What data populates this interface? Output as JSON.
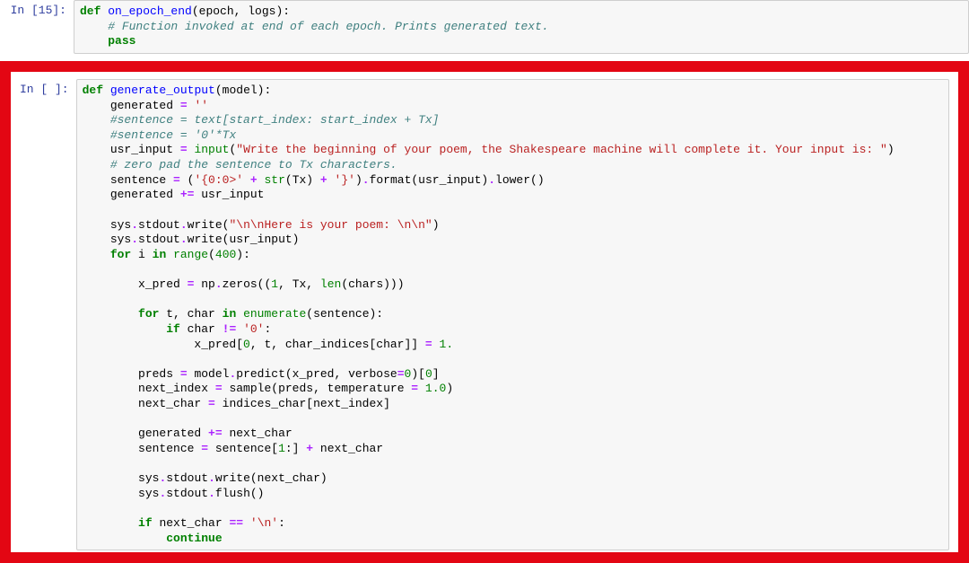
{
  "cell1": {
    "prompt": "In [15]:",
    "lines": [
      [
        [
          "def",
          "kw"
        ],
        [
          " ",
          ""
        ],
        [
          "on_epoch_end",
          "fn"
        ],
        [
          "(epoch, logs):",
          ""
        ]
      ],
      [
        [
          "    ",
          ""
        ],
        [
          "# Function invoked at end of each epoch. Prints generated text.",
          "cm"
        ]
      ],
      [
        [
          "    ",
          ""
        ],
        [
          "pass",
          "kw"
        ]
      ]
    ]
  },
  "cell2": {
    "prompt": "In [ ]:",
    "lines": [
      [
        [
          "def",
          "kw"
        ],
        [
          " ",
          ""
        ],
        [
          "generate_output",
          "fn"
        ],
        [
          "(model):",
          ""
        ]
      ],
      [
        [
          "    generated ",
          ""
        ],
        [
          "=",
          "op"
        ],
        [
          " ",
          ""
        ],
        [
          "''",
          "str"
        ]
      ],
      [
        [
          "    ",
          ""
        ],
        [
          "#sentence = text[start_index: start_index + Tx]",
          "cm"
        ]
      ],
      [
        [
          "    ",
          ""
        ],
        [
          "#sentence = '0'*Tx",
          "cm"
        ]
      ],
      [
        [
          "    usr_input ",
          ""
        ],
        [
          "=",
          "op"
        ],
        [
          " ",
          ""
        ],
        [
          "input",
          "bi"
        ],
        [
          "(",
          ""
        ],
        [
          "\"Write the beginning of your poem, the Shakespeare machine will complete it. Your input is: \"",
          "str"
        ],
        [
          ")",
          ""
        ]
      ],
      [
        [
          "    ",
          ""
        ],
        [
          "# zero pad the sentence to Tx characters.",
          "cm"
        ]
      ],
      [
        [
          "    sentence ",
          ""
        ],
        [
          "=",
          "op"
        ],
        [
          " (",
          ""
        ],
        [
          "'{0:0>'",
          "str"
        ],
        [
          " ",
          ""
        ],
        [
          "+",
          "op"
        ],
        [
          " ",
          ""
        ],
        [
          "str",
          "bi"
        ],
        [
          "(Tx) ",
          ""
        ],
        [
          "+",
          "op"
        ],
        [
          " ",
          ""
        ],
        [
          "'}'",
          "str"
        ],
        [
          ")",
          ""
        ],
        [
          ".",
          "op"
        ],
        [
          "format(usr_input)",
          ""
        ],
        [
          ".",
          "op"
        ],
        [
          "lower()",
          ""
        ]
      ],
      [
        [
          "    generated ",
          ""
        ],
        [
          "+=",
          "op"
        ],
        [
          " usr_input",
          ""
        ]
      ],
      [
        [
          "",
          ""
        ]
      ],
      [
        [
          "    sys",
          ""
        ],
        [
          ".",
          "op"
        ],
        [
          "stdout",
          ""
        ],
        [
          ".",
          "op"
        ],
        [
          "write(",
          ""
        ],
        [
          "\"\\n\\nHere is your poem: \\n\\n\"",
          "str"
        ],
        [
          ")",
          ""
        ]
      ],
      [
        [
          "    sys",
          ""
        ],
        [
          ".",
          "op"
        ],
        [
          "stdout",
          ""
        ],
        [
          ".",
          "op"
        ],
        [
          "write(usr_input)",
          ""
        ]
      ],
      [
        [
          "    ",
          ""
        ],
        [
          "for",
          "kw"
        ],
        [
          " i ",
          ""
        ],
        [
          "in",
          "kw"
        ],
        [
          " ",
          ""
        ],
        [
          "range",
          "bi"
        ],
        [
          "(",
          ""
        ],
        [
          "400",
          "num"
        ],
        [
          "):",
          ""
        ]
      ],
      [
        [
          "",
          ""
        ]
      ],
      [
        [
          "        x_pred ",
          ""
        ],
        [
          "=",
          "op"
        ],
        [
          " np",
          ""
        ],
        [
          ".",
          "op"
        ],
        [
          "zeros((",
          ""
        ],
        [
          "1",
          "num"
        ],
        [
          ", Tx, ",
          ""
        ],
        [
          "len",
          "bi"
        ],
        [
          "(chars)))",
          ""
        ]
      ],
      [
        [
          "",
          ""
        ]
      ],
      [
        [
          "        ",
          ""
        ],
        [
          "for",
          "kw"
        ],
        [
          " t, char ",
          ""
        ],
        [
          "in",
          "kw"
        ],
        [
          " ",
          ""
        ],
        [
          "enumerate",
          "bi"
        ],
        [
          "(sentence):",
          ""
        ]
      ],
      [
        [
          "            ",
          ""
        ],
        [
          "if",
          "kw"
        ],
        [
          " char ",
          ""
        ],
        [
          "!=",
          "op"
        ],
        [
          " ",
          ""
        ],
        [
          "'0'",
          "str"
        ],
        [
          ":",
          ""
        ]
      ],
      [
        [
          "                x_pred[",
          ""
        ],
        [
          "0",
          "num"
        ],
        [
          ", t, char_indices[char]] ",
          ""
        ],
        [
          "=",
          "op"
        ],
        [
          " ",
          ""
        ],
        [
          "1.",
          "num"
        ]
      ],
      [
        [
          "",
          ""
        ]
      ],
      [
        [
          "        preds ",
          ""
        ],
        [
          "=",
          "op"
        ],
        [
          " model",
          ""
        ],
        [
          ".",
          "op"
        ],
        [
          "predict(x_pred, verbose",
          ""
        ],
        [
          "=",
          "op"
        ],
        [
          "0",
          "num"
        ],
        [
          ")[",
          ""
        ],
        [
          "0",
          "num"
        ],
        [
          "]",
          ""
        ]
      ],
      [
        [
          "        next_index ",
          ""
        ],
        [
          "=",
          "op"
        ],
        [
          " sample(preds, temperature ",
          ""
        ],
        [
          "=",
          "op"
        ],
        [
          " ",
          ""
        ],
        [
          "1.0",
          "num"
        ],
        [
          ")",
          ""
        ]
      ],
      [
        [
          "        next_char ",
          ""
        ],
        [
          "=",
          "op"
        ],
        [
          " indices_char[next_index]",
          ""
        ]
      ],
      [
        [
          "",
          ""
        ]
      ],
      [
        [
          "        generated ",
          ""
        ],
        [
          "+=",
          "op"
        ],
        [
          " next_char",
          ""
        ]
      ],
      [
        [
          "        sentence ",
          ""
        ],
        [
          "=",
          "op"
        ],
        [
          " sentence[",
          ""
        ],
        [
          "1",
          "num"
        ],
        [
          ":] ",
          ""
        ],
        [
          "+",
          "op"
        ],
        [
          " next_char",
          ""
        ]
      ],
      [
        [
          "",
          ""
        ]
      ],
      [
        [
          "        sys",
          ""
        ],
        [
          ".",
          "op"
        ],
        [
          "stdout",
          ""
        ],
        [
          ".",
          "op"
        ],
        [
          "write(next_char)",
          ""
        ]
      ],
      [
        [
          "        sys",
          ""
        ],
        [
          ".",
          "op"
        ],
        [
          "stdout",
          ""
        ],
        [
          ".",
          "op"
        ],
        [
          "flush()",
          ""
        ]
      ],
      [
        [
          "",
          ""
        ]
      ],
      [
        [
          "        ",
          ""
        ],
        [
          "if",
          "kw"
        ],
        [
          " next_char ",
          ""
        ],
        [
          "==",
          "op"
        ],
        [
          " ",
          ""
        ],
        [
          "'\\n'",
          "str"
        ],
        [
          ":",
          ""
        ]
      ],
      [
        [
          "            ",
          ""
        ],
        [
          "continue",
          "kw"
        ]
      ]
    ]
  }
}
